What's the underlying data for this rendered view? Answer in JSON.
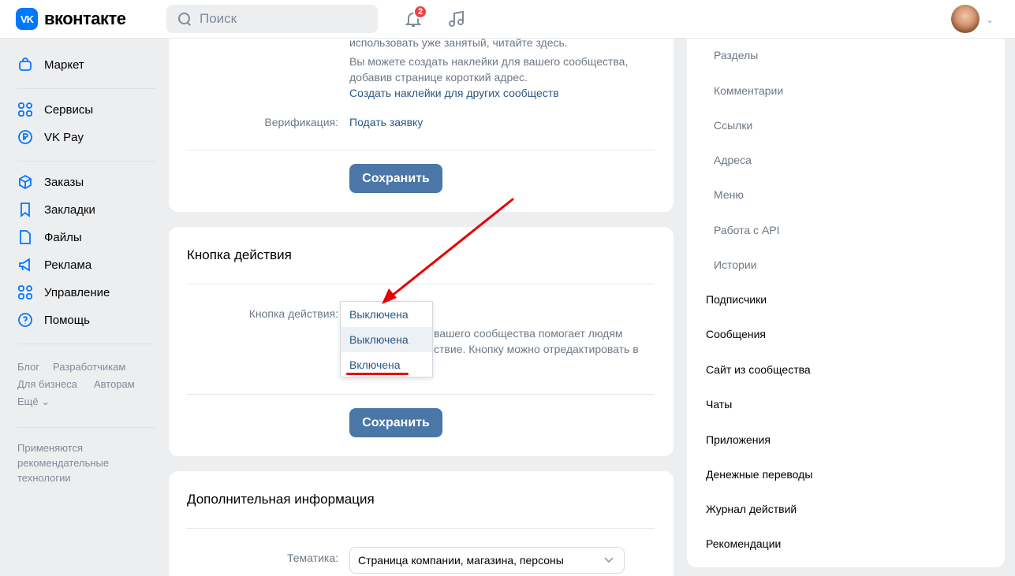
{
  "header": {
    "logo_text": "вконтакте",
    "logo_mark": "VK",
    "search_placeholder": "Поиск",
    "notifications_count": "2",
    "icons": [
      "search-icon",
      "bell-icon",
      "music-icon",
      "chevron-down-icon"
    ]
  },
  "leftnav": {
    "items": [
      {
        "label": "Маркет",
        "icon": "bag-icon"
      },
      {
        "label": "Сервисы",
        "icon": "grid-icon"
      },
      {
        "label": "VK Pay",
        "icon": "ruble-icon"
      },
      {
        "label": "Заказы",
        "icon": "box-icon"
      },
      {
        "label": "Закладки",
        "icon": "bookmark-icon"
      },
      {
        "label": "Файлы",
        "icon": "file-icon"
      },
      {
        "label": "Реклама",
        "icon": "megaphone-icon"
      },
      {
        "label": "Управление",
        "icon": "grid-icon"
      },
      {
        "label": "Помощь",
        "icon": "help-icon"
      }
    ],
    "footer_links": [
      "Блог",
      "Разработчикам",
      "Для бизнеса",
      "Авторам",
      "Ещё ⌄"
    ],
    "recommend_text": "Применяются рекомендательные технологии"
  },
  "card1": {
    "top_text": "использовать уже занятый, читайте здесь.",
    "stickers_text_line1": "Вы можете создать наклейки для вашего сообщества,",
    "stickers_text_line2": "добавив странице короткий адрес.",
    "stickers_link": "Создать наклейки для других сообществ",
    "verification_label": "Верификация:",
    "verification_link": "Подать заявку",
    "save_label": "Сохранить"
  },
  "card2": {
    "title": "Кнопка действия",
    "field_label": "Кнопка действия:",
    "dropdown_options": [
      "Выключена",
      "Выключена",
      "Включена"
    ],
    "desc_line1": "вашего сообщества помогает людям",
    "desc_line2": "ствие. Кнопку можно отредактировать в",
    "save_label": "Сохранить"
  },
  "card3": {
    "title": "Дополнительная информация",
    "topic_label": "Тематика:",
    "topic_value": "Страница компании, магазина, персоны"
  },
  "rightpanel": {
    "subitems": [
      "Разделы",
      "Комментарии",
      "Ссылки",
      "Адреса",
      "Меню",
      "Работа с API",
      "Истории"
    ],
    "items": [
      "Подписчики",
      "Сообщения",
      "Сайт из сообщества",
      "Чаты",
      "Приложения",
      "Денежные переводы",
      "Журнал действий",
      "Рекомендации"
    ]
  },
  "annotation": {
    "arrow_color": "#e80000"
  }
}
